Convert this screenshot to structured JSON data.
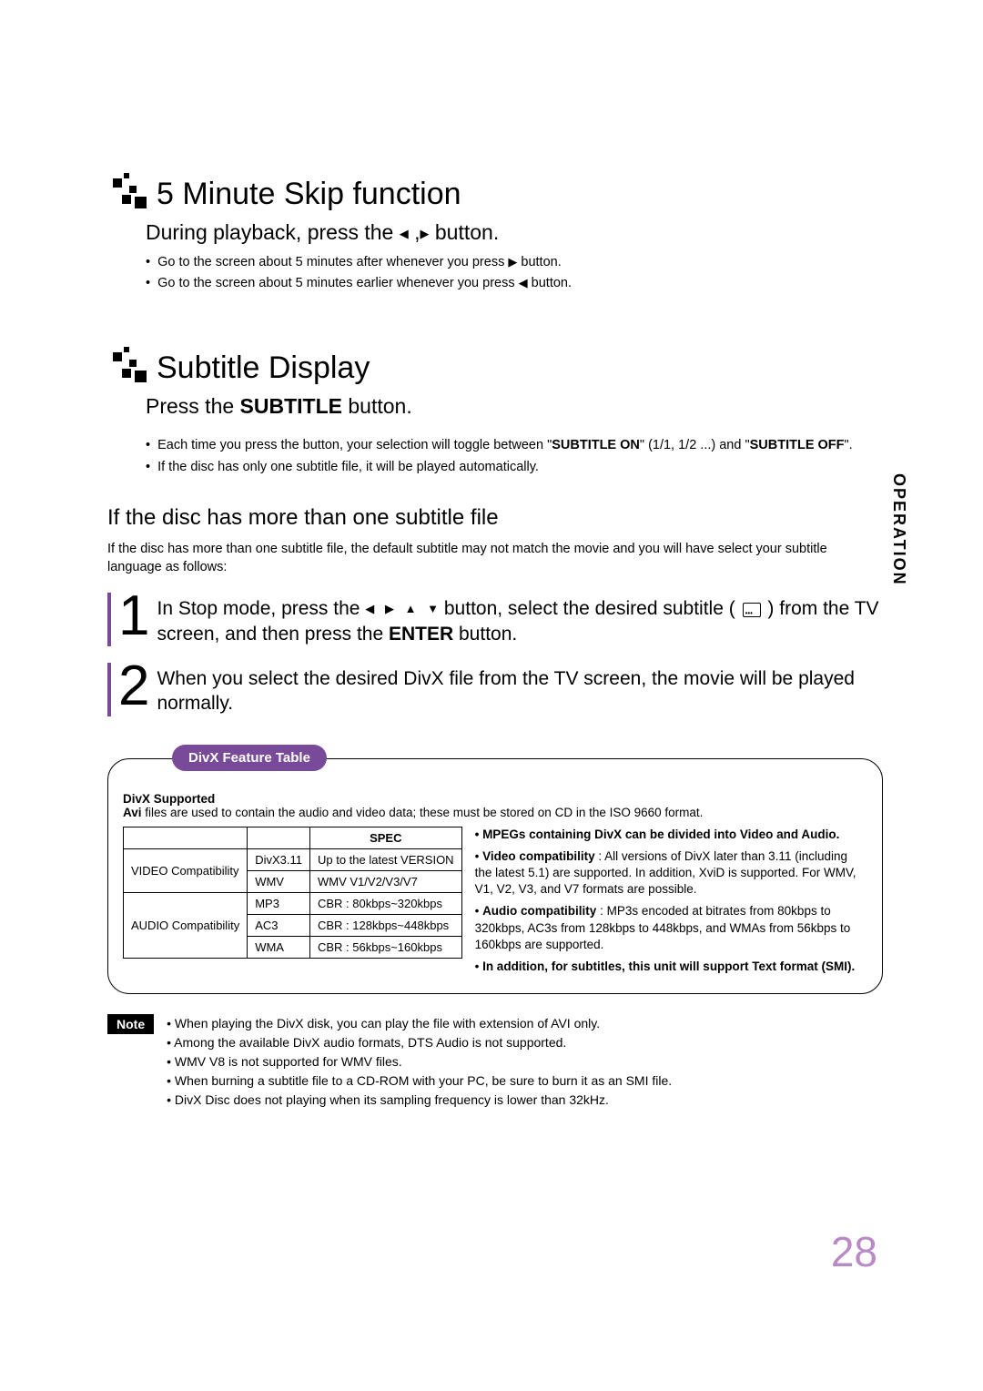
{
  "side_tab": "OPERATION",
  "page_number": "28",
  "section1": {
    "title": "5 Minute Skip function",
    "subtitle_pre": "During playback, press the ",
    "subtitle_post": " button.",
    "bullet1_pre": "Go to the screen about 5 minutes after whenever you press ",
    "bullet1_post": " button.",
    "bullet2_pre": "Go to the screen about 5 minutes earlier whenever you press ",
    "bullet2_post": " button."
  },
  "section2": {
    "title": "Subtitle Display",
    "subtitle_pre": "Press the ",
    "subtitle_bold": "SUBTITLE",
    "subtitle_post": " button.",
    "bullet1_a": "Each time you press the button, your selection will toggle between \"",
    "bullet1_b": "SUBTITLE ON",
    "bullet1_c": "\" (1/1, 1/2 ...) and \"",
    "bullet1_d": "SUBTITLE OFF",
    "bullet1_e": "\".",
    "bullet2": "If the disc has only one subtitle file, it will be played automatically."
  },
  "sub_section": {
    "heading": "If the disc has more than one subtitle file",
    "intro": "If the disc has more than one subtitle file, the default subtitle may not match the movie and you will have select your subtitle language as follows:",
    "step1_num": "1",
    "step1_a": "In Stop mode, press the ",
    "step1_b": " button, select the desired subtitle ( ",
    "step1_c": " ) from the TV screen, and then press the ",
    "step1_d": "ENTER",
    "step1_e": " button.",
    "step2_num": "2",
    "step2": "When you select the desired DivX file from the TV screen, the movie will be played normally."
  },
  "feature": {
    "tab": "DivX Feature Table",
    "intro_bold": "DivX Supported",
    "intro_a": "Avi",
    "intro_b": " files are used to contain the audio and video data; these must be stored on CD in the ISO 9660 format.",
    "table": {
      "spec_header": "SPEC",
      "rows": [
        {
          "c1": "VIDEO Compatibility",
          "c2": "DivX3.11",
          "c3": "Up to the latest VERSION"
        },
        {
          "c1": "",
          "c2": "WMV",
          "c3": "WMV V1/V2/V3/V7"
        },
        {
          "c1": "AUDIO Compatibility",
          "c2": "MP3",
          "c3": "CBR : 80kbps~320kbps"
        },
        {
          "c1": "",
          "c2": "AC3",
          "c3": "CBR : 128kbps~448kbps"
        },
        {
          "c1": "",
          "c2": "WMA",
          "c3": "CBR : 56kbps~160kbps"
        }
      ]
    },
    "right_heading": "MPEGs containing DivX can be divided into Video and Audio.",
    "right_item1_bold": "Video compatibility",
    "right_item1_text": " : All versions of DivX later than 3.11 (including the latest 5.1) are supported. In addition, XviD is supported. For WMV, V1, V2, V3, and V7 formats are possible.",
    "right_item2_bold": "Audio compatibility",
    "right_item2_text": " : MP3s encoded at bitrates from 80kbps to 320kbps, AC3s from 128kbps to 448kbps, and WMAs from 56kbps to 160kbps are supported.",
    "right_item3": "In addition, for subtitles, this unit will support Text format (SMI)."
  },
  "note": {
    "label": "Note",
    "items": [
      "When playing the DivX disk, you can play the file with extension of AVI only.",
      "Among the available DivX audio formats, DTS Audio is not supported.",
      "WMV V8 is not supported for WMV files.",
      "When burning a subtitle file to a CD-ROM with your PC, be sure to burn it as an SMI file.",
      "DivX Disc does not playing when its sampling frequency is lower than 32kHz."
    ]
  }
}
